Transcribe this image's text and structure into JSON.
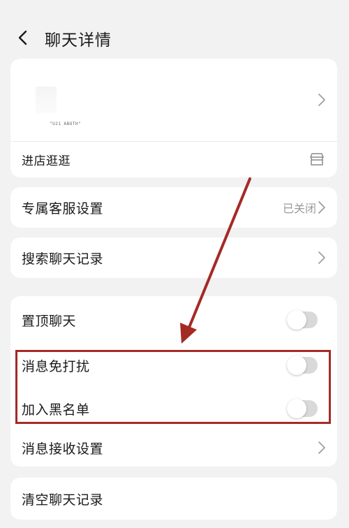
{
  "header": {
    "back_icon": "chevron-left-icon",
    "title": "聊天详情"
  },
  "shop": {
    "subtitle": "\"U21 ABOTH\"",
    "visit_label": "进店逛逛",
    "visit_icon": "store-icon"
  },
  "settings": {
    "exclusive_service": {
      "label": "专属客服设置",
      "value": "已关闭"
    },
    "search_history": {
      "label": "搜索聊天记录"
    },
    "pin_chat": {
      "label": "置顶聊天",
      "enabled": false
    },
    "do_not_disturb": {
      "label": "消息免打扰",
      "enabled": false
    },
    "blacklist": {
      "label": "加入黑名单",
      "enabled": false
    },
    "receive_settings": {
      "label": "消息接收设置"
    },
    "clear_history": {
      "label": "清空聊天记录"
    }
  },
  "annotation": {
    "color": "#a42a26"
  },
  "colors": {
    "background": "#f2f2f2",
    "card": "#ffffff",
    "toggle_off": "#d9d9d9",
    "secondary_text": "#9a9a9a"
  }
}
